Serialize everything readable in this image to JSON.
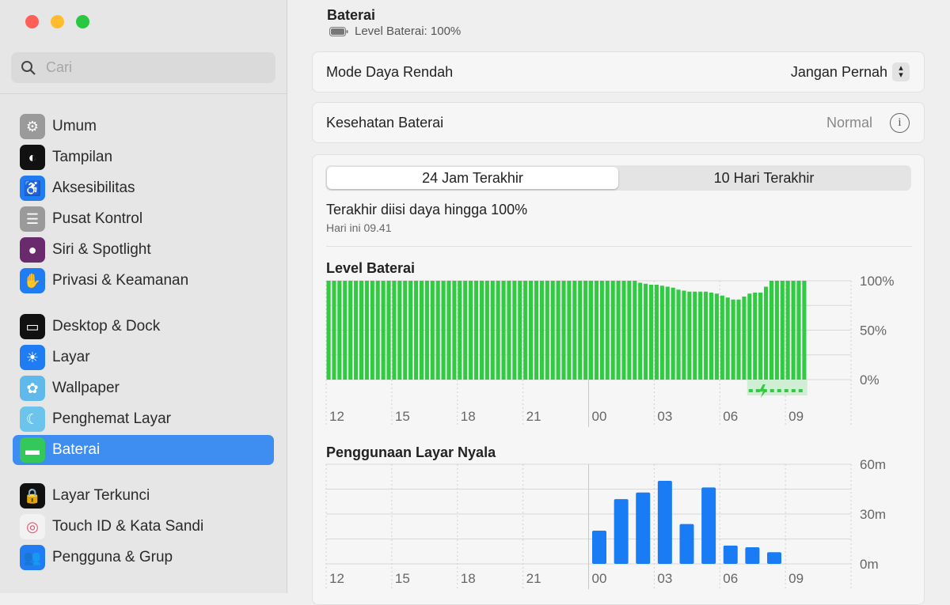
{
  "window": {
    "controls": [
      "close",
      "minimize",
      "zoom"
    ],
    "colors": {
      "close": "#fe5f57",
      "minimize": "#febc2e",
      "zoom": "#28c840"
    }
  },
  "sidebar": {
    "search_placeholder": "Cari",
    "items": [
      {
        "label": "Umum",
        "icon": "gear-icon",
        "color": "#9a9a9a"
      },
      {
        "label": "Tampilan",
        "icon": "appearance-icon",
        "color": "#111111"
      },
      {
        "label": "Aksesibilitas",
        "icon": "accessibility-icon",
        "color": "#1f7cf2"
      },
      {
        "label": "Pusat Kontrol",
        "icon": "control-center-icon",
        "color": "#9a9a9a"
      },
      {
        "label": "Siri & Spotlight",
        "icon": "siri-icon",
        "color": "#6a2a6e"
      },
      {
        "label": "Privasi & Keamanan",
        "icon": "hand-icon",
        "color": "#1f7cf2"
      },
      {
        "label": "Desktop & Dock",
        "icon": "dock-icon",
        "color": "#111111"
      },
      {
        "label": "Layar",
        "icon": "sun-icon",
        "color": "#1f7cf2"
      },
      {
        "label": "Wallpaper",
        "icon": "flower-icon",
        "color": "#5fb9ea"
      },
      {
        "label": "Penghemat Layar",
        "icon": "screensaver-icon",
        "color": "#6cc3ec"
      },
      {
        "label": "Baterai",
        "icon": "battery-icon",
        "color": "#34c759",
        "selected": true
      },
      {
        "label": "Layar Terkunci",
        "icon": "lock-icon",
        "color": "#111111"
      },
      {
        "label": "Touch ID & Kata Sandi",
        "icon": "fingerprint-icon",
        "color": "#f2f2f2"
      },
      {
        "label": "Pengguna & Grup",
        "icon": "users-icon",
        "color": "#1f7cf2"
      }
    ]
  },
  "header": {
    "title": "Baterai",
    "subtitle": "Level Baterai: 100%"
  },
  "low_power": {
    "label": "Mode Daya Rendah",
    "value": "Jangan Pernah"
  },
  "health": {
    "label": "Kesehatan Baterai",
    "value": "Normal"
  },
  "tabs": [
    {
      "label": "24 Jam Terakhir",
      "active": true
    },
    {
      "label": "10 Hari Terakhir",
      "active": false
    }
  ],
  "last_charged": {
    "title": "Terakhir diisi daya hingga 100%",
    "time": "Hari ini 09.41"
  },
  "chart_data": [
    {
      "type": "bar",
      "title": "Level Baterai",
      "color": "#2fcb41",
      "x_ticks": [
        "12",
        "15",
        "18",
        "21",
        "00",
        "03",
        "06",
        "09"
      ],
      "y_ticks": [
        "100%",
        "50%",
        "0%"
      ],
      "ylim": [
        0,
        100
      ],
      "grid": true,
      "start": "12:00",
      "interval_minutes": 15,
      "values": [
        100,
        100,
        100,
        100,
        100,
        100,
        100,
        100,
        100,
        100,
        100,
        100,
        100,
        100,
        100,
        100,
        100,
        100,
        100,
        100,
        100,
        100,
        100,
        100,
        100,
        100,
        100,
        100,
        100,
        100,
        100,
        100,
        100,
        100,
        100,
        100,
        100,
        100,
        100,
        100,
        100,
        100,
        100,
        100,
        100,
        100,
        100,
        100,
        100,
        100,
        100,
        100,
        100,
        100,
        100,
        100,
        100,
        98,
        97,
        96,
        96,
        95,
        94,
        93,
        91,
        90,
        89,
        89,
        89,
        89,
        88,
        87,
        85,
        83,
        81,
        81,
        84,
        87,
        88,
        88,
        94,
        100,
        100,
        100,
        100,
        100,
        100,
        100
      ],
      "charging": {
        "from": "07:15",
        "to": "09:45"
      }
    },
    {
      "type": "bar",
      "title": "Penggunaan Layar Nyala",
      "color": "#1a7cf5",
      "x_ticks": [
        "12",
        "15",
        "18",
        "21",
        "00",
        "03",
        "06",
        "09"
      ],
      "y_ticks": [
        "60m",
        "30m",
        "0m"
      ],
      "ylim": [
        0,
        60
      ],
      "grid": true,
      "categories": [
        "00",
        "01",
        "02",
        "03",
        "04",
        "05",
        "06",
        "07",
        "08"
      ],
      "values": [
        20,
        39,
        43,
        50,
        24,
        46,
        11,
        10,
        7
      ]
    }
  ]
}
